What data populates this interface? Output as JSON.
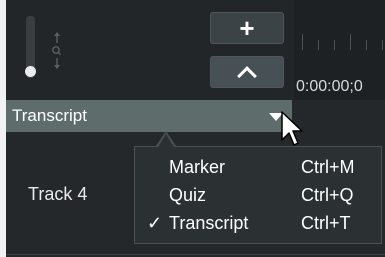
{
  "toolbar": {
    "add_icon": "plus-icon",
    "collapse_icon": "chevron-up-icon"
  },
  "zoom": {
    "icon": "zoom-slider-icon",
    "level": 0.0
  },
  "timeline": {
    "timecode": "0:00:00;0"
  },
  "tracks": {
    "transcript": {
      "label": "Transcript",
      "dropdown_icon": "triangle-down-icon"
    },
    "track4": {
      "label": "Track 4"
    }
  },
  "menu": {
    "items": [
      {
        "check": "",
        "label": "Marker",
        "shortcut": "Ctrl+M"
      },
      {
        "check": "",
        "label": "Quiz",
        "shortcut": "Ctrl+Q"
      },
      {
        "check": "✓",
        "label": "Transcript",
        "shortcut": "Ctrl+T"
      }
    ]
  },
  "colors": {
    "background": "#232628",
    "track_header": "#5e6d6c",
    "menu_bg": "#2b3033",
    "text": "#ffffff"
  }
}
